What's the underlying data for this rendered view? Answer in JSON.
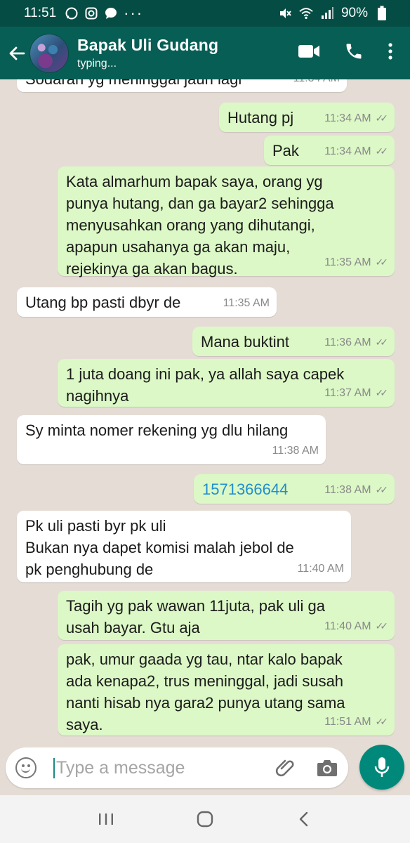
{
  "status_bar": {
    "time": "11:51",
    "dots": "···",
    "battery": "90%"
  },
  "header": {
    "contact_name": "Bapak Uli Gudang",
    "status": "typing..."
  },
  "messages": [
    {
      "dir": "in",
      "text": "Sodaran yg meninggal jauh lagi",
      "time": "11:34 AM"
    },
    {
      "dir": "out",
      "text": "Hutang pj",
      "time": "11:34 AM"
    },
    {
      "dir": "out",
      "text": "Pak",
      "time": "11:34 AM"
    },
    {
      "dir": "out",
      "lines": [
        "Kata almarhum bapak saya, orang yg",
        "punya hutang, dan ga bayar2 sehingga",
        "menyusahkan orang yang dihutangi,",
        "apapun usahanya ga akan maju,",
        "rejekinya ga akan bagus."
      ],
      "time": "11:35 AM"
    },
    {
      "dir": "in",
      "text": "Utang bp pasti dbyr de",
      "time": "11:35 AM"
    },
    {
      "dir": "out",
      "text": "Mana buktint",
      "time": "11:36 AM"
    },
    {
      "dir": "out",
      "lines": [
        "1 juta doang ini pak, ya allah saya capek",
        "nagihnya"
      ],
      "time": "11:37 AM"
    },
    {
      "dir": "in",
      "text": "Sy minta nomer rekening yg dlu hilang",
      "time": "11:38 AM"
    },
    {
      "dir": "out",
      "text": "1571366644",
      "time": "11:38 AM"
    },
    {
      "dir": "in",
      "lines": [
        "Pk uli pasti byr pk uli",
        "Bukan nya dapet komisi malah jebol de",
        "pk penghubung de"
      ],
      "time": "11:40 AM"
    },
    {
      "dir": "out",
      "lines": [
        "Tagih yg pak wawan 11juta, pak uli ga",
        "usah bayar. Gtu aja"
      ],
      "time": "11:40 AM"
    },
    {
      "dir": "out",
      "lines": [
        "pak, umur gaada yg tau, ntar kalo bapak",
        "ada kenapa2, trus meninggal, jadi susah",
        "nanti hisab nya gara2 punya utang sama",
        "saya."
      ],
      "time": "11:51 AM"
    }
  ],
  "composer": {
    "placeholder": "Type a message"
  },
  "icons": {
    "back": "arrow-left-icon",
    "video": "video-call-icon",
    "call": "phone-icon",
    "menu": "more-vert-icon",
    "emoji": "emoji-icon",
    "attach": "paperclip-icon",
    "camera": "camera-icon",
    "mic": "microphone-icon",
    "nav_recent": "recents-icon",
    "nav_home": "home-icon",
    "nav_back": "back-icon"
  },
  "colors": {
    "header": "#075e54",
    "status_bar": "#054d44",
    "outgoing": "#dcf8c6",
    "incoming": "#ffffff",
    "fab": "#00897b",
    "link": "#1f8fd1"
  }
}
